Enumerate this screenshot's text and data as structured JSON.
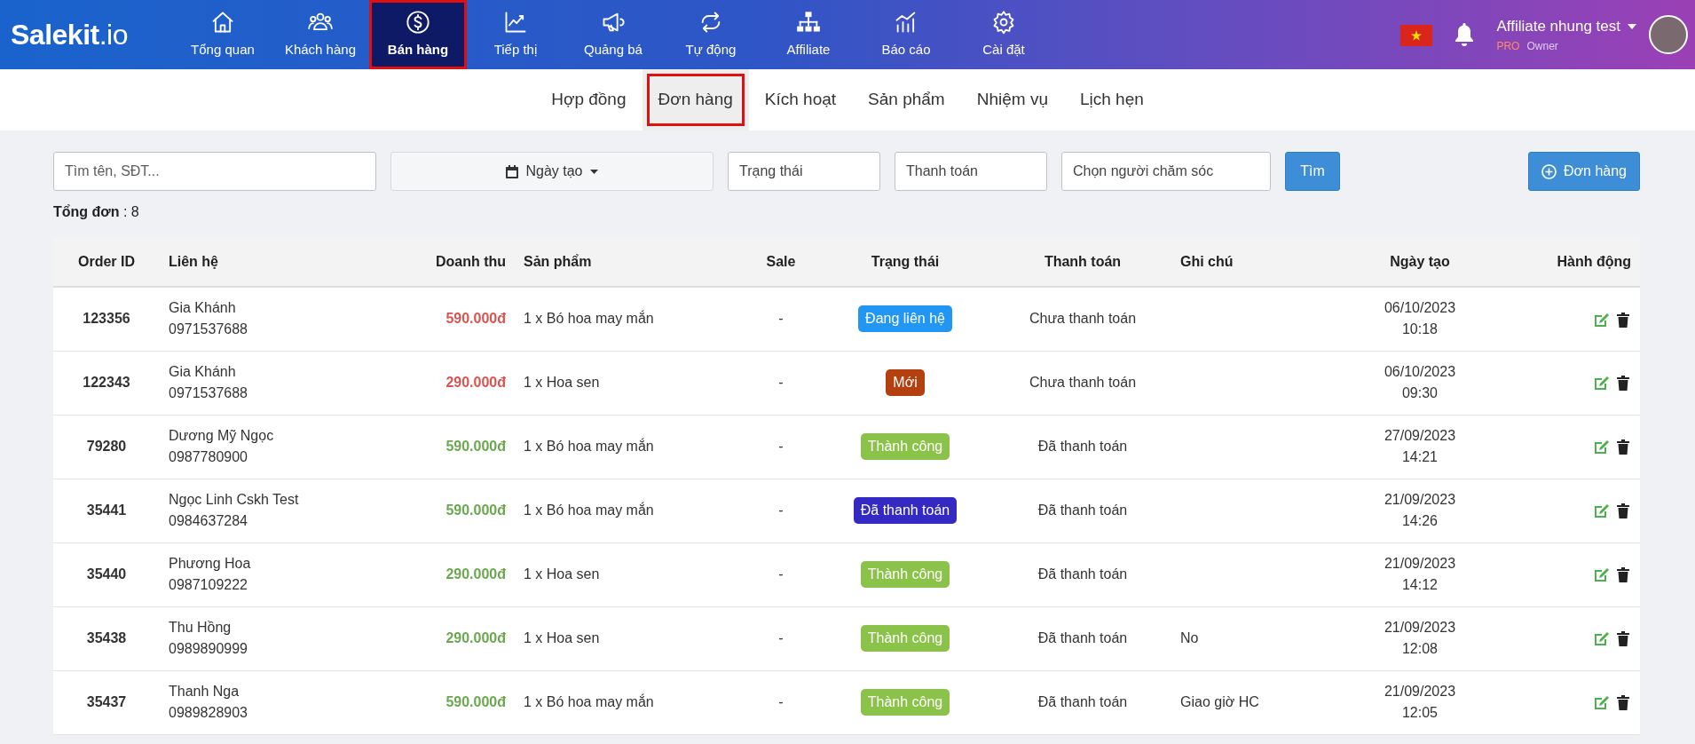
{
  "brand": {
    "name": "Salekit",
    "suffix": ".io"
  },
  "nav": [
    {
      "label": "Tổng quan",
      "selected": false
    },
    {
      "label": "Khách hàng",
      "selected": false
    },
    {
      "label": "Bán hàng",
      "selected": true
    },
    {
      "label": "Tiếp thị",
      "selected": false
    },
    {
      "label": "Quảng bá",
      "selected": false
    },
    {
      "label": "Tự động",
      "selected": false
    },
    {
      "label": "Affiliate",
      "selected": false
    },
    {
      "label": "Báo cáo",
      "selected": false
    },
    {
      "label": "Cài đặt",
      "selected": false
    }
  ],
  "user": {
    "name": "Affiliate nhung test",
    "plan": "PRO",
    "role": "Owner"
  },
  "subnav": [
    {
      "label": "Hợp đồng",
      "selected": false
    },
    {
      "label": "Đơn hàng",
      "selected": true
    },
    {
      "label": "Kích hoạt",
      "selected": false
    },
    {
      "label": "Sản phẩm",
      "selected": false
    },
    {
      "label": "Nhiệm vụ",
      "selected": false
    },
    {
      "label": "Lịch hẹn",
      "selected": false
    }
  ],
  "filters": {
    "search": {
      "placeholder": "Tìm tên, SĐT..."
    },
    "date_button": "Ngày tạo",
    "status_select": "Trạng thái",
    "payment_select": "Thanh toán",
    "caretaker_select": "Chọn người chăm sóc",
    "search_button": "Tìm",
    "add_button": "Đơn hàng"
  },
  "summary": {
    "text": "**Tổng đơn** : 8"
  },
  "table": {
    "columns": [
      "Order ID",
      "Liên hệ",
      "Doanh thu",
      "Sản phẩm",
      "Sale",
      "Trạng thái",
      "Thanh toán",
      "Ghi chú",
      "Ngày tạo",
      "Hành động"
    ],
    "rows": [
      {
        "id": "123356",
        "name": "Gia Khánh",
        "phone": "0971537688",
        "revenue": "590.000đ",
        "paid": false,
        "product": "1 x Bó hoa may mắn",
        "sale": "-",
        "status": "Đang liên hệ",
        "color": "#2196f3",
        "payment": "Chưa thanh toán",
        "date": "06/10/2023",
        "time": "10:18"
      },
      {
        "id": "122343",
        "name": "Gia Khánh",
        "phone": "0971537688",
        "revenue": "290.000đ",
        "paid": false,
        "product": "1 x Hoa sen",
        "sale": "-",
        "status": "Mới",
        "color": "#b5400f",
        "payment": "Chưa thanh toán",
        "date": "06/10/2023",
        "time": "09:30"
      },
      {
        "id": "79280",
        "name": "Dương Mỹ Ngọc",
        "phone": "0987780900",
        "revenue": "590.000đ",
        "paid": true,
        "product": "1 x Bó hoa may mắn",
        "sale": "-",
        "status": "Thành công",
        "color": "#8bc34a",
        "payment": "Đã thanh toán",
        "date": "27/09/2023",
        "time": "14:21"
      },
      {
        "id": "35441",
        "name": "Ngọc Linh Cskh Test",
        "phone": "0984637284",
        "revenue": "590.000đ",
        "paid": true,
        "product": "1 x Bó hoa may mắn",
        "sale": "-",
        "status": "Đã thanh toán",
        "color": "#3529c4",
        "payment": "Đã thanh toán",
        "date": "21/09/2023",
        "time": "14:26"
      },
      {
        "id": "35440",
        "name": "Phương Hoa",
        "phone": "0987109222",
        "revenue": "290.000đ",
        "paid": true,
        "product": "1 x Hoa sen",
        "sale": "-",
        "status": "Thành công",
        "color": "#8bc34a",
        "payment": "Đã thanh toán",
        "date": "21/09/2023",
        "time": "14:12"
      },
      {
        "id": "35438",
        "name": "Thu Hồng",
        "phone": "0989890999",
        "revenue": "290.000đ",
        "paid": true,
        "product": "1 x Hoa sen",
        "sale": "-",
        "status": "Thành công",
        "color": "#8bc34a",
        "payment": "Đã thanh toán",
        "note": "No",
        "date": "21/09/2023",
        "time": "12:08"
      },
      {
        "id": "35437",
        "name": "Thanh Nga",
        "phone": "0989828903",
        "revenue": "590.000đ",
        "paid": true,
        "product": "1 x Bó hoa may mắn",
        "sale": "-",
        "status": "Thành công",
        "color": "#8bc34a",
        "payment": "Đã thanh toán",
        "note": "Giao giờ HC",
        "date": "21/09/2023",
        "time": "12:05"
      }
    ]
  }
}
